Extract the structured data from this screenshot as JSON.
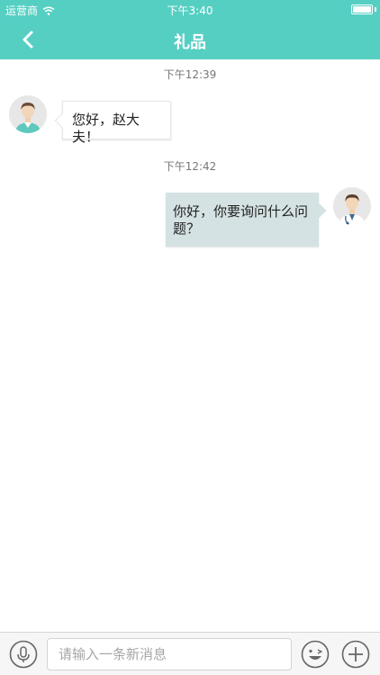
{
  "status_bar": {
    "carrier": "运营商",
    "time": "下午3:40"
  },
  "nav": {
    "title": "礼品"
  },
  "messages": [
    {
      "time": "下午12:39",
      "direction": "incoming",
      "text": "您好，赵大夫！"
    },
    {
      "time": "下午12:42",
      "direction": "outgoing",
      "text": "你好，你要询问什么问题？"
    }
  ],
  "input_bar": {
    "placeholder": "请输入一条新消息"
  },
  "colors": {
    "header": "#56cfc3",
    "outgoing_bubble": "#d5e2e3",
    "incoming_bubble": "#ffffff"
  },
  "icons": [
    "back-chevron-icon",
    "wifi-icon",
    "battery-icon",
    "microphone-icon",
    "emoji-icon",
    "plus-icon"
  ]
}
